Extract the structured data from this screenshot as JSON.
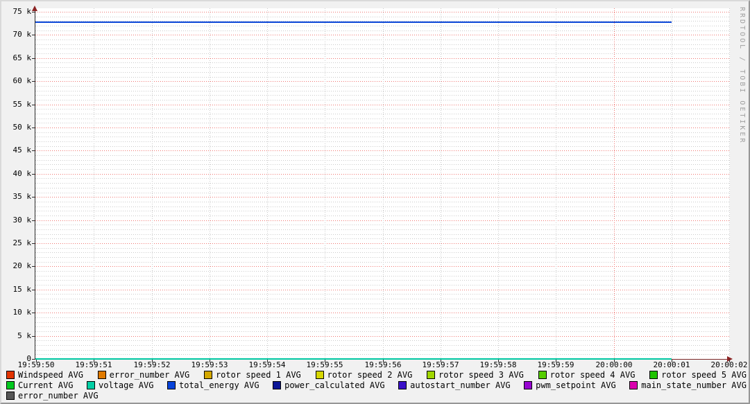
{
  "watermark": "RRDTOOL / TOBI OETIKER",
  "chart_data": {
    "type": "line",
    "title": "",
    "xlabel": "",
    "ylabel": "",
    "grid": "on",
    "legend_position": "bottom",
    "x_tick_labels": [
      "19:59:50",
      "19:59:51",
      "19:59:52",
      "19:59:53",
      "19:59:54",
      "19:59:55",
      "19:59:56",
      "19:59:57",
      "19:59:58",
      "19:59:59",
      "20:00:00",
      "20:00:01",
      "20:00:02"
    ],
    "x_major_ticks": [
      "20:00:00"
    ],
    "y_tick_labels": [
      "0",
      "5 k",
      "10 k",
      "15 k",
      "20 k",
      "25 k",
      "30 k",
      "35 k",
      "40 k",
      "45 k",
      "50 k",
      "55 k",
      "60 k",
      "65 k",
      "70 k",
      "75 k"
    ],
    "ylim": [
      0,
      75000
    ],
    "y_major_step": 5000,
    "y_minor_step": 1000,
    "grid_colors": {
      "major": "#f07470",
      "minor": "#cacaca"
    },
    "series": [
      {
        "name": "total_energy AVG",
        "color": "#0b46d8",
        "approx_value": 72700,
        "x_start": "19:59:50",
        "x_end": "20:00:01"
      },
      {
        "name": "voltage AVG",
        "color": "#00c8a2",
        "approx_value": 0,
        "x_start": "19:59:50",
        "x_end": "20:00:01"
      }
    ],
    "legend_rows": [
      [
        {
          "label": "Windspeed AVG",
          "color": "#e23400"
        },
        {
          "label": "error_number AVG",
          "color": "#e07a00"
        },
        {
          "label": "rotor speed 1 AVG",
          "color": "#d4a800"
        },
        {
          "label": "rotor speed 2 AVG",
          "color": "#d6d600"
        },
        {
          "label": "rotor speed 3 AVG",
          "color": "#a0d600"
        },
        {
          "label": "rotor speed 4 AVG",
          "color": "#56ce00"
        },
        {
          "label": "rotor speed 5 AVG",
          "color": "#1ec300"
        }
      ],
      [
        {
          "label": "Current AVG",
          "color": "#00c81e"
        },
        {
          "label": "voltage AVG",
          "color": "#00cea4"
        },
        {
          "label": "total_energy AVG",
          "color": "#0743d9"
        },
        {
          "label": "power_calculated AVG",
          "color": "#0b1596"
        },
        {
          "label": "autostart_number AVG",
          "color": "#3a11c8"
        },
        {
          "label": "pwm_setpoint AVG",
          "color": "#9705d1"
        },
        {
          "label": "main_state_number AVG",
          "color": "#db00ae"
        }
      ],
      [
        {
          "label": "error_number AVG",
          "color": "#565656"
        }
      ]
    ]
  }
}
